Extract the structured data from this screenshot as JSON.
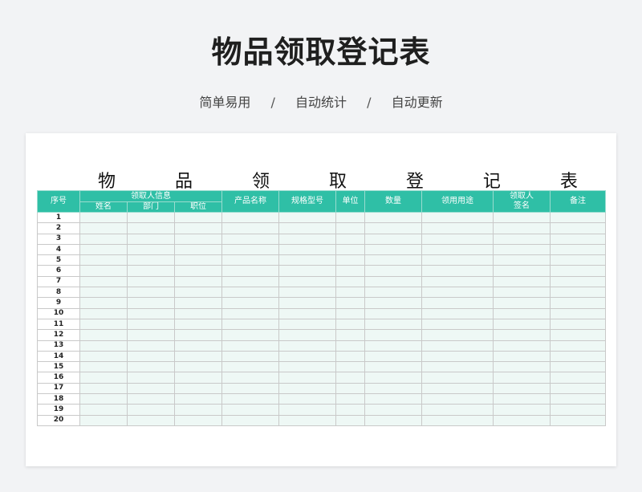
{
  "page": {
    "title": "物品领取登记表",
    "features": [
      "简单易用",
      "自动统计",
      "自动更新"
    ],
    "separator": "/"
  },
  "sheet": {
    "title_chars": [
      "物",
      "品",
      "领",
      "取",
      "登",
      "记",
      "表"
    ],
    "headers": {
      "seq": "序号",
      "receiver_info": "领取人信息",
      "name": "姓名",
      "dept": "部门",
      "position": "职位",
      "product": "产品名称",
      "spec": "规格型号",
      "unit": "单位",
      "qty": "数量",
      "usage": "领用用途",
      "signature_line1": "领取人",
      "signature_line2": "签名",
      "note": "备注"
    },
    "rows": [
      "1",
      "2",
      "3",
      "4",
      "5",
      "6",
      "7",
      "8",
      "9",
      "10",
      "11",
      "12",
      "13",
      "14",
      "15",
      "16",
      "17",
      "18",
      "19",
      "20"
    ]
  },
  "colors": {
    "header_bg": "#2fbfa6",
    "cell_bg": "#eef8f5"
  }
}
